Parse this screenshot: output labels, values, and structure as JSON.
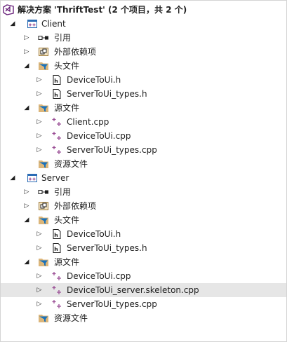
{
  "solution": {
    "label": "解决方案 'ThriftTest' (2 个项目，共 2 个)",
    "icon": "solution-icon"
  },
  "colors": {
    "solution_purple": "#68217a",
    "folder_tan": "#dcb67a",
    "filter_folder_blue": "#1a72bb",
    "project_icon_blue": "#2b6cb5",
    "cpp_plus_purple": "#9b4f96",
    "selected_row_bg": "#e6e6e6",
    "text": "#1e1e1e"
  },
  "projects": [
    {
      "name": "Client",
      "references": "引用",
      "external_deps": "外部依赖项",
      "header_files": {
        "label": "头文件",
        "files": [
          "DeviceToUi.h",
          "ServerToUi_types.h"
        ]
      },
      "source_files": {
        "label": "源文件",
        "files": [
          "Client.cpp",
          "DeviceToUi.cpp",
          "ServerToUi_types.cpp"
        ]
      },
      "resource_files": "资源文件"
    },
    {
      "name": "Server",
      "references": "引用",
      "external_deps": "外部依赖项",
      "header_files": {
        "label": "头文件",
        "files": [
          "DeviceToUi.h",
          "ServerToUi_types.h"
        ]
      },
      "source_files": {
        "label": "源文件",
        "files": [
          "DeviceToUi.cpp",
          "DeviceToUi_server.skeleton.cpp",
          "ServerToUi_types.cpp"
        ]
      },
      "resource_files": "资源文件"
    }
  ],
  "selected_item": "DeviceToUi_server.skeleton.cpp"
}
